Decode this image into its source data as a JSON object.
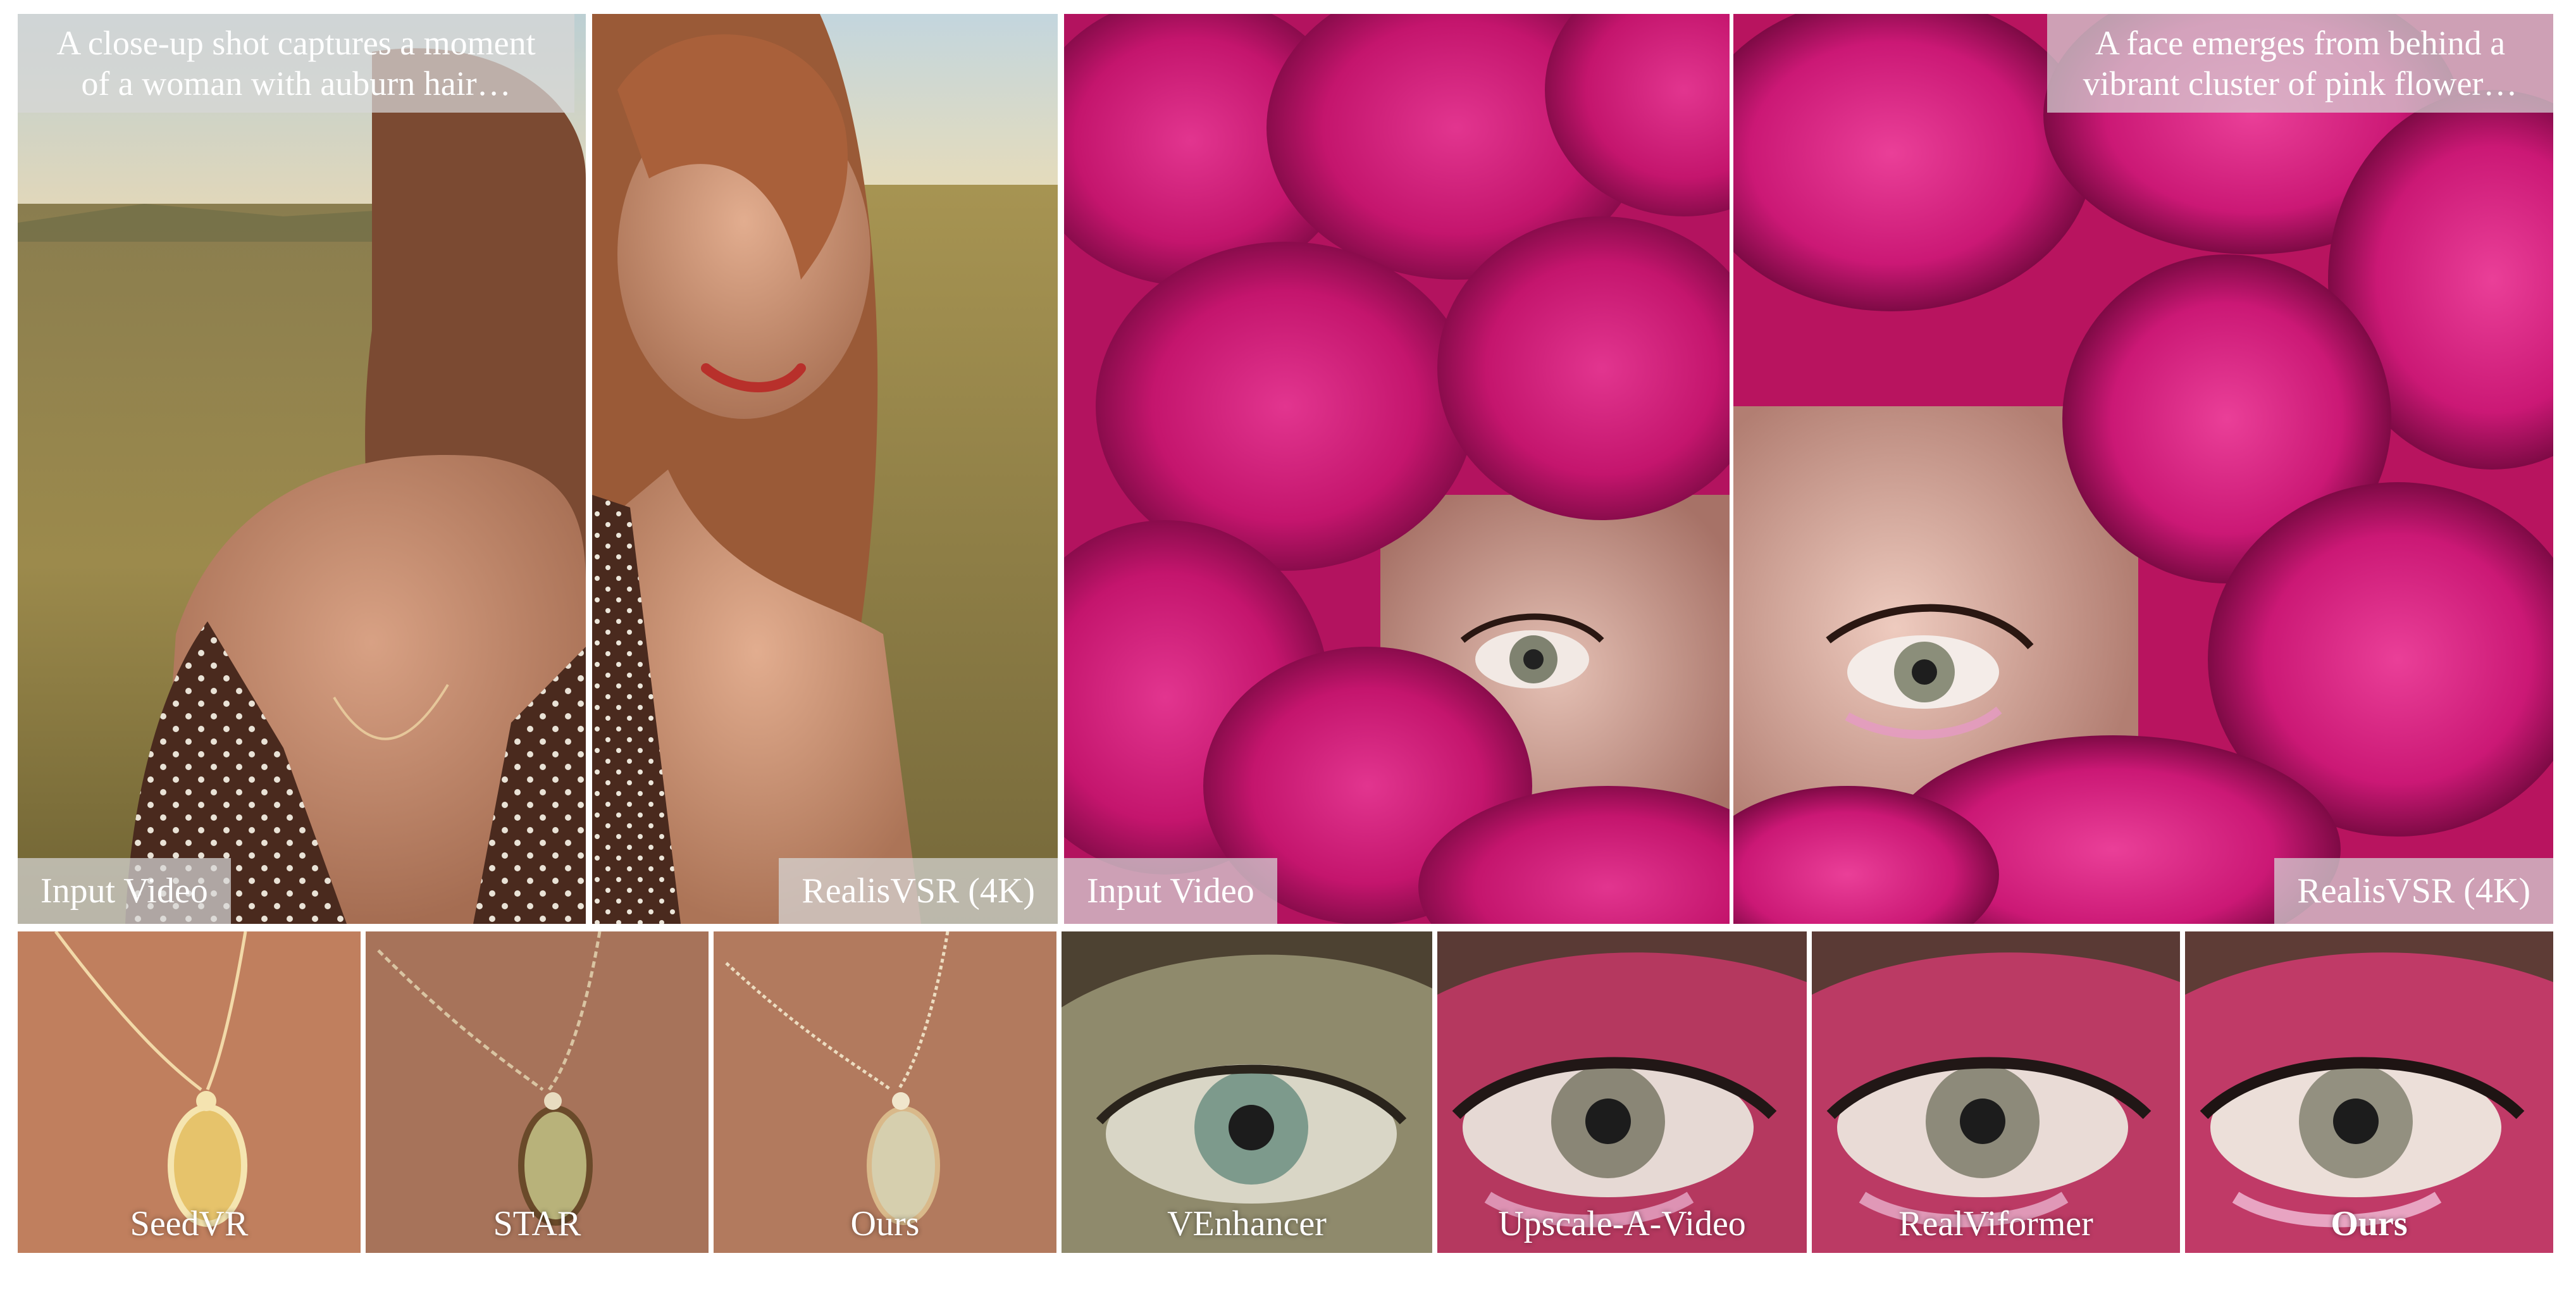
{
  "top": {
    "woman_caption": "A close-up shot captures a moment of a woman with auburn hair…",
    "flower_caption": "A face emerges from behind a vibrant cluster of pink flower…",
    "woman_input_label": "Input Video",
    "woman_output_label": "RealisVSR (4K)",
    "flower_input_label": "Input Video",
    "flower_output_label": "RealisVSR (4K)"
  },
  "bottom": {
    "labels": [
      "SeedVR",
      "STAR",
      "Ours",
      "VEnhancer",
      "Upscale-A-Video",
      "RealViformer",
      "Ours"
    ]
  },
  "colors": {
    "flower_magenta": "#c8166f",
    "skin": "#b07a5e",
    "field": "#8f7e45",
    "sky": "#a9c3c9"
  }
}
